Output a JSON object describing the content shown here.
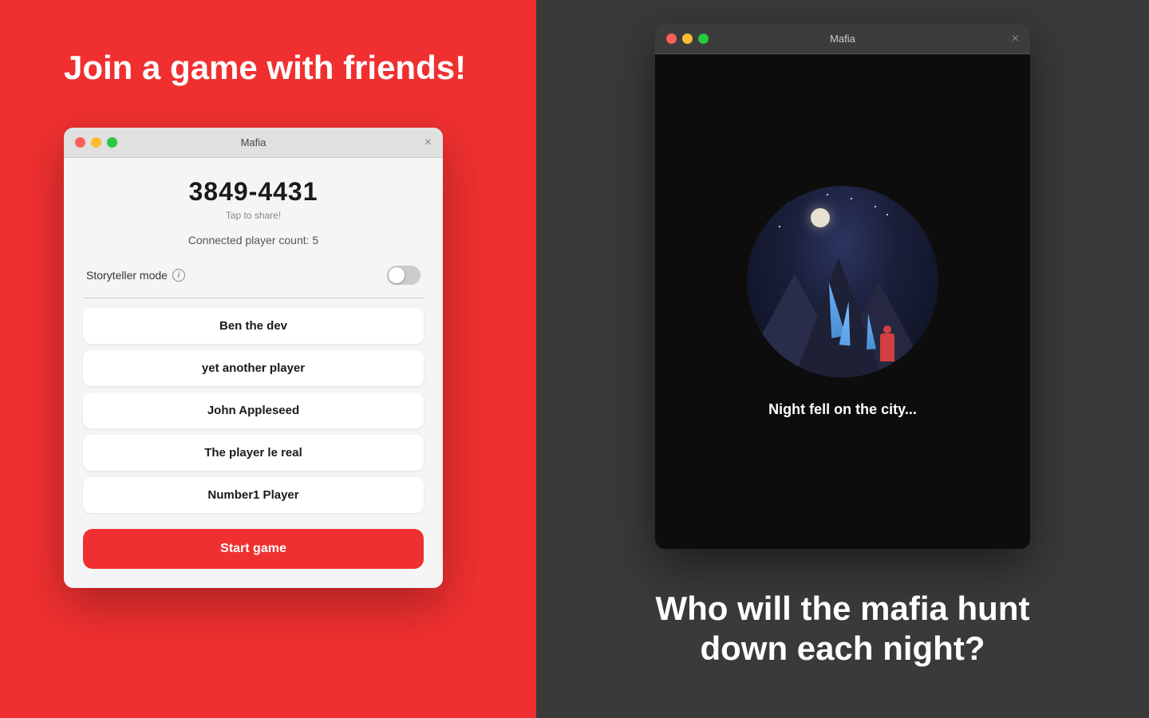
{
  "left": {
    "heading": "Join a game with friends!",
    "window": {
      "title": "Mafia",
      "close_btn": "×",
      "game_code": "3849-4431",
      "tap_to_share": "Tap to share!",
      "player_count_label": "Connected player count: 5",
      "storyteller_label": "Storyteller mode",
      "players": [
        {
          "name": "Ben the dev"
        },
        {
          "name": "yet another player"
        },
        {
          "name": "John Appleseed"
        },
        {
          "name": "The player le real"
        },
        {
          "name": "Number1 Player"
        }
      ],
      "start_button_label": "Start game"
    }
  },
  "right": {
    "window": {
      "title": "Mafia",
      "close_btn": "×"
    },
    "night_text": "Night fell on the city...",
    "heading_line1": "Who will the mafia hunt",
    "heading_line2": "down each night?"
  },
  "icons": {
    "info": "i",
    "tl_red": "#ff5f57",
    "tl_yellow": "#febc2e",
    "tl_green": "#28c840"
  }
}
